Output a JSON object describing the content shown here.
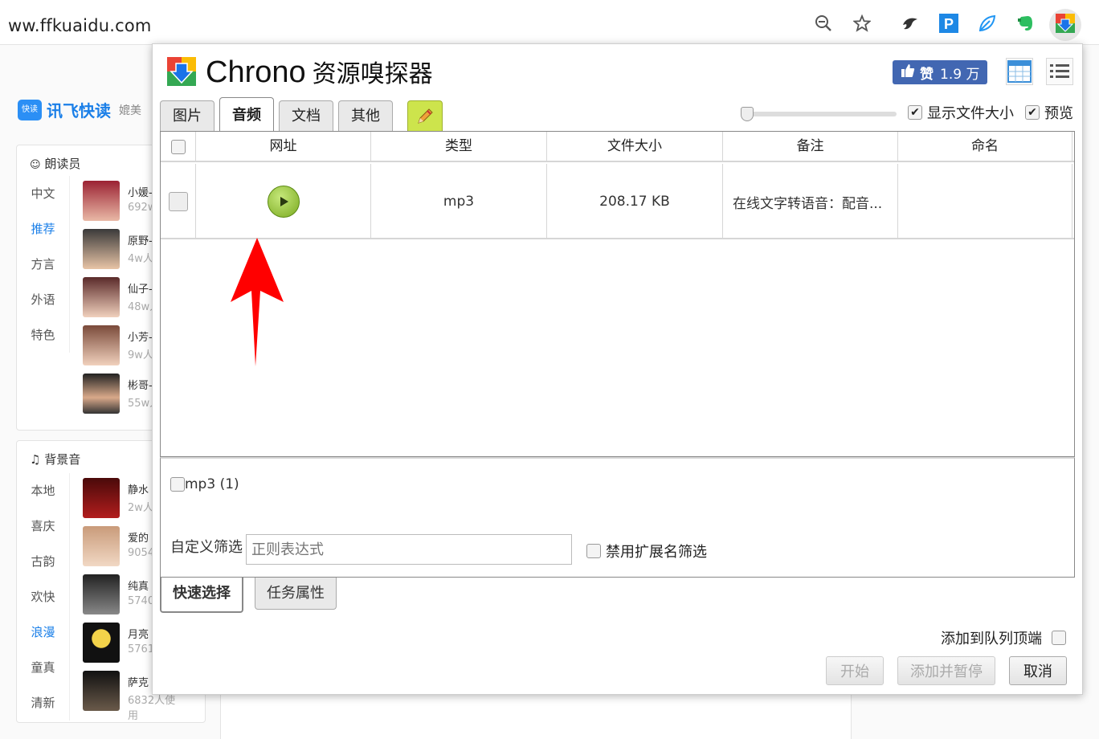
{
  "browser": {
    "url": "ww.ffkuaidu.com",
    "icons": [
      "zoom-out-icon",
      "star-icon",
      "bird-extension-icon",
      "p-extension-icon",
      "leaf-extension-icon",
      "evernote-icon",
      "chrono-extension-icon"
    ]
  },
  "site": {
    "logo_mark": "快读",
    "logo_name": "讯飞快读",
    "logo_tag": "媲美",
    "readers_panel": {
      "title": "朗读员",
      "categories": [
        "中文",
        "推荐",
        "方言",
        "外语",
        "特色"
      ],
      "active_category": "推荐",
      "voices": [
        {
          "name": "小媛-",
          "count": "692w"
        },
        {
          "name": "原野-",
          "count": "4w人"
        },
        {
          "name": "仙子-",
          "count": "48w人"
        },
        {
          "name": "小芳-",
          "count": "9w人"
        },
        {
          "name": "彬哥-",
          "count": "55w人"
        }
      ]
    },
    "music_panel": {
      "title": "背景音",
      "categories": [
        "本地",
        "喜庆",
        "古韵",
        "欢快",
        "浪漫",
        "童真",
        "清新"
      ],
      "active_category": "浪漫",
      "tracks": [
        {
          "name": "静水",
          "count": "2w人"
        },
        {
          "name": "爱的",
          "count": "9054"
        },
        {
          "name": "纯真",
          "count": "5740"
        },
        {
          "name": "月亮",
          "count": "5761"
        },
        {
          "name": "萨克",
          "count": "6832人使用"
        }
      ]
    }
  },
  "popup": {
    "title_en": "Chrono",
    "title_cn": "资源嗅探器",
    "like_label": "赞",
    "like_count": "1.9 万",
    "tabs": [
      "图片",
      "音频",
      "文档",
      "其他"
    ],
    "active_tab": "音频",
    "show_size_label": "显示文件大小",
    "preview_label": "预览",
    "columns": [
      "网址",
      "类型",
      "文件大小",
      "备注",
      "命名"
    ],
    "rows": [
      {
        "type": "mp3",
        "size": "208.17 KB",
        "note": "在线文字转语音：配音...",
        "name": ""
      }
    ],
    "type_filter": "mp3 (1)",
    "custom_filter_label": "自定义筛选",
    "regex_placeholder": "正则表达式",
    "disable_ext_label": "禁用扩展名筛选",
    "bottom_tabs": [
      "快速选择",
      "任务属性"
    ],
    "queue_top_label": "添加到队列顶端",
    "buttons": {
      "start": "开始",
      "add_pause": "添加并暂停",
      "cancel": "取消"
    }
  }
}
